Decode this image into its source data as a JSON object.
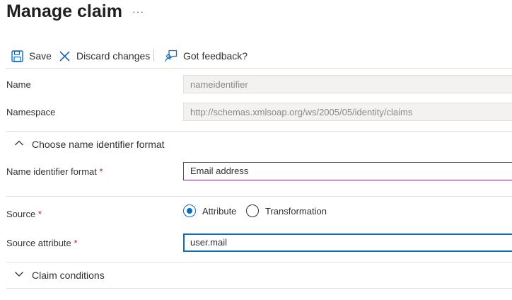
{
  "header": {
    "title": "Manage claim",
    "more_label": "···"
  },
  "toolbar": {
    "save_label": "Save",
    "discard_label": "Discard changes",
    "feedback_label": "Got feedback?"
  },
  "fields": {
    "name": {
      "label": "Name",
      "value": "nameidentifier"
    },
    "namespace": {
      "label": "Namespace",
      "value": "http://schemas.xmlsoap.org/ws/2005/05/identity/claims"
    }
  },
  "name_identifier_section": {
    "title": "Choose name identifier format",
    "format_label": "Name identifier format",
    "format_value": "Email address",
    "required_mark": "*"
  },
  "source": {
    "label": "Source",
    "required_mark": "*",
    "options": [
      "Attribute",
      "Transformation"
    ],
    "selected": "Attribute"
  },
  "source_attribute": {
    "label": "Source attribute",
    "required_mark": "*",
    "value": "user.mail"
  },
  "claim_conditions": {
    "title": "Claim conditions"
  },
  "colors": {
    "accent": "#0f6cbd",
    "required": "#a4262c",
    "dropdown_border": "#8a2d8a"
  }
}
